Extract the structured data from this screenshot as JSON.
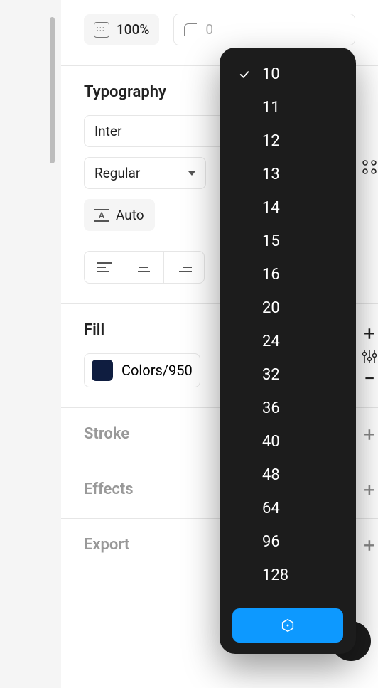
{
  "opacity": {
    "value": "100%"
  },
  "radius": {
    "placeholder": "0"
  },
  "typography": {
    "title": "Typography",
    "font": "Inter",
    "weight": "Regular",
    "lineHeight": "Auto"
  },
  "fill": {
    "title": "Fill",
    "swatchName": "Colors/950",
    "swatchHex": "#0f1d40"
  },
  "sections": {
    "stroke": "Stroke",
    "effects": "Effects",
    "export": "Export"
  },
  "sizeDropdown": {
    "selected": "10",
    "options": [
      "10",
      "11",
      "12",
      "13",
      "14",
      "15",
      "16",
      "20",
      "24",
      "32",
      "36",
      "40",
      "48",
      "64",
      "96",
      "128"
    ]
  }
}
